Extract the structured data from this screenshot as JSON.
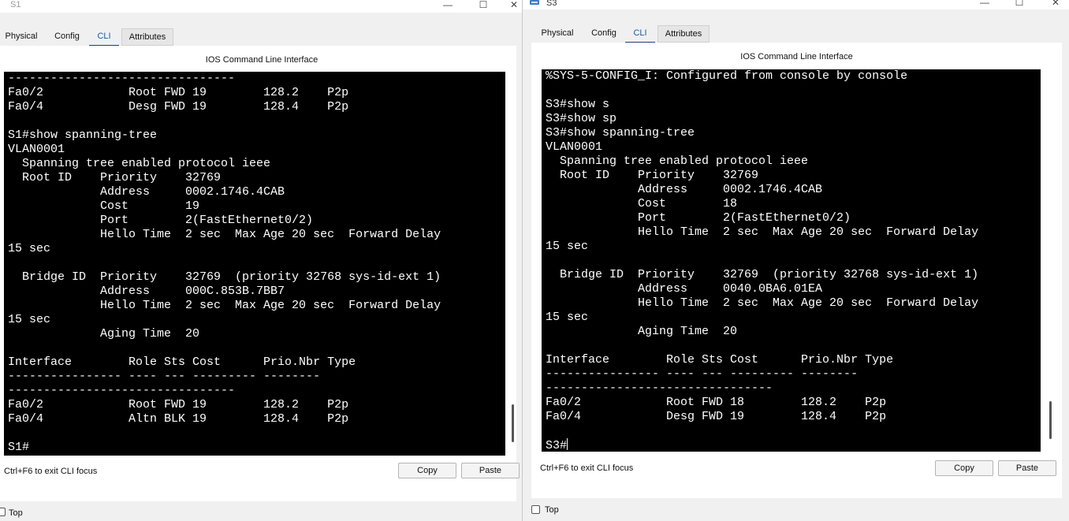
{
  "windows": {
    "s1": {
      "title": "S1",
      "tabs": [
        "Physical",
        "Config",
        "CLI",
        "Attributes"
      ],
      "active_tab": "CLI",
      "cli_title": "IOS Command Line Interface",
      "terminal_lines": [
        "--------------------------------",
        "Fa0/2            Root FWD 19        128.2    P2p",
        "Fa0/4            Desg FWD 19        128.4    P2p",
        "",
        "S1#show spanning-tree",
        "VLAN0001",
        "  Spanning tree enabled protocol ieee",
        "  Root ID    Priority    32769",
        "             Address     0002.1746.4CAB",
        "             Cost        19",
        "             Port        2(FastEthernet0/2)",
        "             Hello Time  2 sec  Max Age 20 sec  Forward Delay",
        "15 sec",
        "",
        "  Bridge ID  Priority    32769  (priority 32768 sys-id-ext 1)",
        "             Address     000C.853B.7BB7",
        "             Hello Time  2 sec  Max Age 20 sec  Forward Delay",
        "15 sec",
        "             Aging Time  20",
        "",
        "Interface        Role Sts Cost      Prio.Nbr Type",
        "---------------- ---- --- --------- --------",
        "--------------------------------",
        "Fa0/2            Root FWD 19        128.2    P2p",
        "Fa0/4            Altn BLK 19        128.4    P2p",
        "",
        "S1#"
      ],
      "hint": "Ctrl+F6 to exit CLI focus",
      "copy_label": "Copy",
      "paste_label": "Paste",
      "top_label": "Top"
    },
    "s3": {
      "title": "S3",
      "tabs": [
        "Physical",
        "Config",
        "CLI",
        "Attributes"
      ],
      "active_tab": "CLI",
      "cli_title": "IOS Command Line Interface",
      "terminal_lines": [
        "%SYS-5-CONFIG_I: Configured from console by console",
        "",
        "S3#show s",
        "S3#show sp",
        "S3#show spanning-tree",
        "VLAN0001",
        "  Spanning tree enabled protocol ieee",
        "  Root ID    Priority    32769",
        "             Address     0002.1746.4CAB",
        "             Cost        18",
        "             Port        2(FastEthernet0/2)",
        "             Hello Time  2 sec  Max Age 20 sec  Forward Delay",
        "15 sec",
        "",
        "  Bridge ID  Priority    32769  (priority 32768 sys-id-ext 1)",
        "             Address     0040.0BA6.01EA",
        "             Hello Time  2 sec  Max Age 20 sec  Forward Delay",
        "15 sec",
        "             Aging Time  20",
        "",
        "Interface        Role Sts Cost      Prio.Nbr Type",
        "---------------- ---- --- --------- --------",
        "--------------------------------",
        "Fa0/2            Root FWD 18        128.2    P2p",
        "Fa0/4            Desg FWD 19        128.4    P2p",
        "",
        "S3#"
      ],
      "hint": "Ctrl+F6 to exit CLI focus",
      "copy_label": "Copy",
      "paste_label": "Paste",
      "top_label": "Top"
    }
  },
  "window_controls": {
    "minimize": "—",
    "maximize": "☐",
    "close": "✕"
  },
  "colors": {
    "terminal_bg": "#000000",
    "terminal_fg": "#ffffff",
    "active_tab_underline": "#1f3f74"
  }
}
